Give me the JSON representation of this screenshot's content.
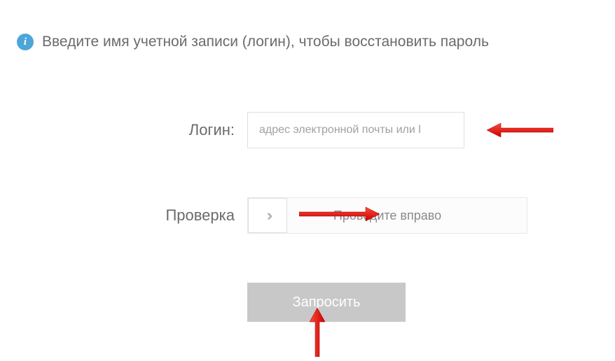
{
  "info": {
    "text": "Введите имя учетной записи (логин), чтобы восстановить пароль"
  },
  "form": {
    "login_label": "Логин:",
    "login_placeholder": "адрес электронной почты или l",
    "verify_label": "Проверка",
    "slider_text": "Проведите вправо",
    "submit_label": "Запросить"
  }
}
